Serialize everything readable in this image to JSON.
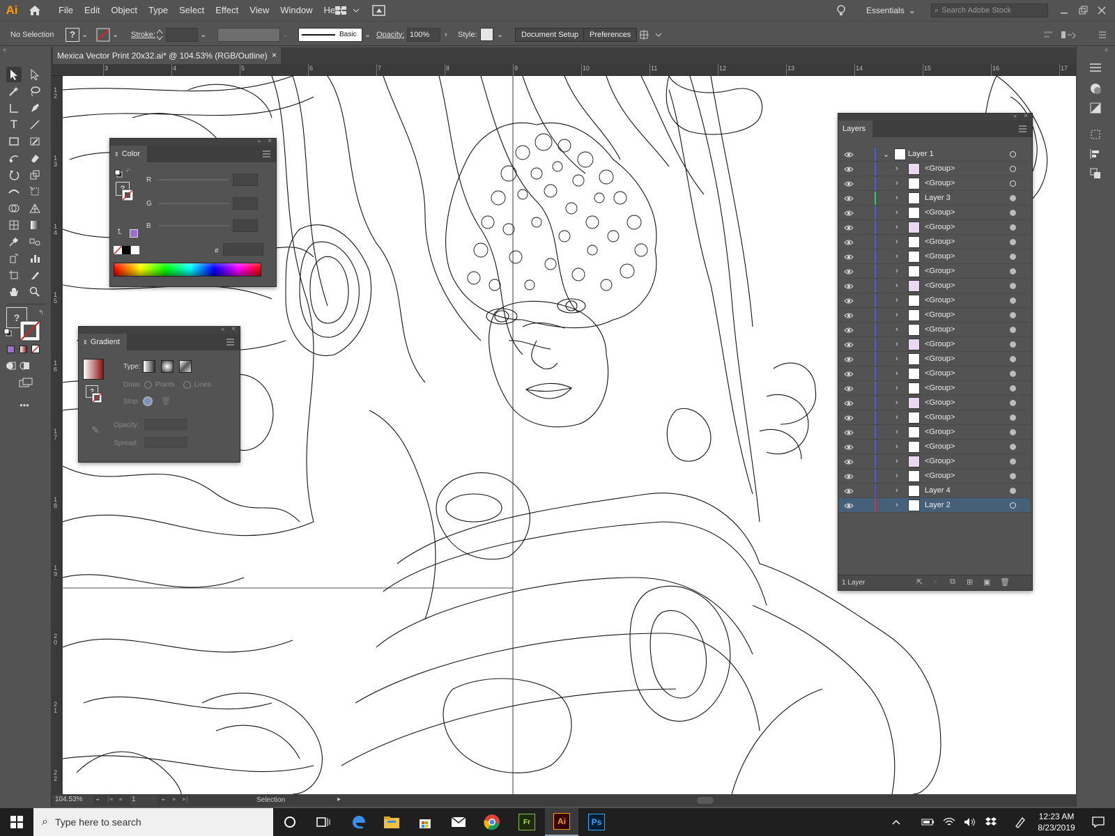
{
  "app": {
    "logo": "Ai"
  },
  "menu": [
    "File",
    "Edit",
    "Object",
    "Type",
    "Select",
    "Effect",
    "View",
    "Window",
    "Help"
  ],
  "workspace": {
    "name": "Essentials",
    "search_placeholder": "Search Adobe Stock"
  },
  "control": {
    "selection": "No Selection",
    "stroke_label": "Stroke:",
    "stroke_style": "Basic",
    "opacity_label": "Opacity:",
    "opacity_value": "100%",
    "style_label": "Style:",
    "document_setup": "Document Setup",
    "preferences": "Preferences"
  },
  "document": {
    "tab_title": "Mexica Vector Print 20x32.ai* @ 104.53% (RGB/Outline)",
    "close": "×"
  },
  "ruler": {
    "h_ticks": [
      "3",
      "4",
      "5",
      "6",
      "7",
      "8",
      "9",
      "10",
      "11",
      "12",
      "13",
      "14",
      "15",
      "16",
      "17"
    ],
    "v_ticks": [
      "1 2",
      "1 3",
      "1 4",
      "1 5",
      "1 6",
      "1 7",
      "1 8",
      "1 9",
      "2 0",
      "2 1",
      "2 2"
    ]
  },
  "color_panel": {
    "title": "Color",
    "r": "R",
    "g": "G",
    "b": "B",
    "hex": "#",
    "swatch_color": "#9c6fce"
  },
  "gradient_panel": {
    "title": "Gradient",
    "type": "Type:",
    "draw": "Draw:",
    "points": "Points",
    "lines": "Lines",
    "stop": "Stop:",
    "opacity": "Opacity:",
    "spread": "Spread:",
    "gradient_start": "#ffffff",
    "gradient_end": "#8b1010"
  },
  "layers_panel": {
    "title": "Layers",
    "footer": "1 Layer",
    "rows": [
      {
        "name": "Layer 1",
        "bar": "#4060e0",
        "expanded": true,
        "top": true
      },
      {
        "name": "<Group>",
        "bar": "#4060e0"
      },
      {
        "name": "<Group>",
        "bar": "#4060e0"
      },
      {
        "name": "Layer 3",
        "bar": "#2fcf5f"
      },
      {
        "name": "<Group>",
        "bar": "#4060e0"
      },
      {
        "name": "<Group>",
        "bar": "#4060e0"
      },
      {
        "name": "<Group>",
        "bar": "#4060e0"
      },
      {
        "name": "<Group>",
        "bar": "#4060e0"
      },
      {
        "name": "<Group>",
        "bar": "#4060e0"
      },
      {
        "name": "<Group>",
        "bar": "#4060e0"
      },
      {
        "name": "<Group>",
        "bar": "#4060e0"
      },
      {
        "name": "<Group>",
        "bar": "#4060e0"
      },
      {
        "name": "<Group>",
        "bar": "#4060e0"
      },
      {
        "name": "<Group>",
        "bar": "#4060e0"
      },
      {
        "name": "<Group>",
        "bar": "#4060e0"
      },
      {
        "name": "<Group>",
        "bar": "#4060e0"
      },
      {
        "name": "<Group>",
        "bar": "#4060e0"
      },
      {
        "name": "<Group>",
        "bar": "#4060e0"
      },
      {
        "name": "<Group>",
        "bar": "#4060e0"
      },
      {
        "name": "<Group>",
        "bar": "#4060e0"
      },
      {
        "name": "<Group>",
        "bar": "#4060e0"
      },
      {
        "name": "<Group>",
        "bar": "#4060e0"
      },
      {
        "name": "<Group>",
        "bar": "#4060e0"
      },
      {
        "name": "Layer 4",
        "bar": "#5050d0"
      },
      {
        "name": "Layer 2",
        "bar": "#e03030",
        "selected": true
      }
    ]
  },
  "status": {
    "zoom": "104.53%",
    "artboard": "1",
    "tool": "Selection"
  },
  "taskbar": {
    "search_placeholder": "Type here to search",
    "time": "12:23 AM",
    "date": "8/23/2019",
    "fr_label": "Fr",
    "ai_label": "Ai",
    "ps_label": "Ps"
  }
}
